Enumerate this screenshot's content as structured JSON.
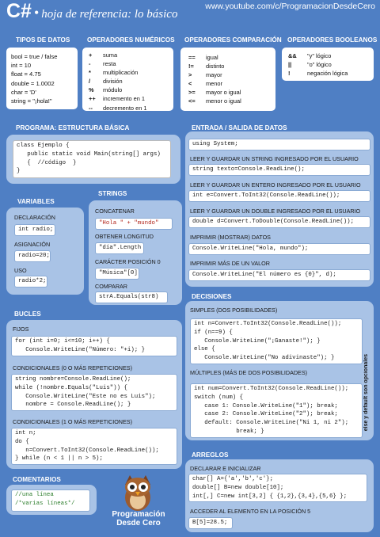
{
  "header": {
    "title": "C#",
    "separator": "•",
    "subtitle": "hoja de referencia: lo básico",
    "url": "www.youtube.com/c/ProgramacionDesdeCero"
  },
  "tipos": {
    "heading": "TIPOS DE DATOS",
    "lines": [
      "bool = true / false",
      "int = 10",
      "float = 4.75",
      "double = 1.0002",
      "char = 'D'",
      "string = \"¡hola!\""
    ]
  },
  "numericos": {
    "heading": "OPERADORES NUMÉRICOS",
    "rows": [
      [
        "+",
        "suma"
      ],
      [
        "-",
        "resta"
      ],
      [
        "*",
        "multiplicación"
      ],
      [
        "/",
        "división"
      ],
      [
        "%",
        "módulo"
      ],
      [
        "++",
        "incremento en 1"
      ],
      [
        "--",
        "decremento en 1"
      ]
    ]
  },
  "comparacion": {
    "heading": "OPERADORES COMPARACIÓN",
    "rows": [
      [
        "==",
        "igual"
      ],
      [
        "!=",
        "distinto"
      ],
      [
        ">",
        "mayor"
      ],
      [
        "<",
        "menor"
      ],
      [
        ">=",
        "mayor o igual"
      ],
      [
        "<=",
        "menor o igual"
      ]
    ]
  },
  "booleanos": {
    "heading": "OPERADORES BOOLEANOS",
    "rows": [
      [
        "&&",
        "\"y\" lógico"
      ],
      [
        "||",
        "\"o\" lógico"
      ],
      [
        "!",
        "negación lógica"
      ]
    ]
  },
  "programa": {
    "heading": "PROGRAMA: ESTRUCTURA BÁSICA",
    "code": [
      "class Ejemplo {",
      "   public static void Main(string[] args)",
      "   {  //código  }",
      "}"
    ]
  },
  "variables": {
    "heading": "VARIABLES",
    "declaracion_label": "DECLARACIÓN",
    "declaracion_code": "int radio;",
    "asignacion_label": "ASIGNACIÓN",
    "asignacion_code": "radio=20;",
    "uso_label": "USO",
    "uso_code": "radio*2;"
  },
  "strings": {
    "heading": "STRINGS",
    "concat_label": "CONCATENAR",
    "concat_code": "\"Hola \" + \"mundo\"",
    "longitud_label": "OBTENER LONGITUD",
    "longitud_code": "\"día\".Length",
    "caracter_label": "CARÁCTER POSICIÓN 0",
    "caracter_code": "\"Música\"[0]",
    "comparar_label": "COMPARAR",
    "comparar_code": "strA.Equals(str8)"
  },
  "entrada": {
    "heading": "ENTRADA / SALIDA DE DATOS",
    "using_code": "using System;",
    "leer_string_label": "LEER Y GUARDAR UN STRING INGRESADO POR EL USUARIO",
    "leer_string_code": "string texto=Console.ReadLine();",
    "leer_entero_label": "LEER Y GUARDAR UN ENTERO INGRESADO POR EL USUARIO",
    "leer_entero_code": "int e=Convert.ToInt32(Console.ReadLine());",
    "leer_double_label": "LEER Y GUARDAR UN DOUBLE INGRESADO POR EL USUARIO",
    "leer_double_code": "double d=Convert.ToDouble(Console.ReadLine());",
    "imprimir_label": "IMPRIMIR (MOSTRAR) DATOS",
    "imprimir_code": "Console.WriteLine(\"Hola, mundo\");",
    "imprimir_mas_label": "IMPRIMIR MÁS DE UN VALOR",
    "imprimir_mas_code": "Console.WriteLine(\"El número es {0}\", d);"
  },
  "bucles": {
    "heading": "BUCLES",
    "fijos_label": "FIJOS",
    "fijos_code": [
      "for (int i=0; i<=10; i++) {",
      "   Console.WriteLine(\"Número: \"+i); }"
    ],
    "cond0_label": "CONDICIONALES (0 O MÁS REPETICIONES)",
    "cond0_code": [
      "string nombre=Console.ReadLine();",
      "while (!nombre.Equals(\"Luis\")) {",
      "   Console.WriteLine(\"Este no es Luis\");",
      "   nombre = Console.ReadLine(); }"
    ],
    "cond1_label": "CONDICIONALES (1 O MÁS REPETICIONES)",
    "cond1_code": [
      "int n;",
      "do {",
      "   n=Convert.ToInt32(Console.ReadLine());",
      "} while (n < 1 || n > 5);"
    ]
  },
  "decisiones": {
    "heading": "DECISIONES",
    "simples_label": "SIMPLES (DOS POSIBILIDADES)",
    "simples_code": [
      "int n=Convert.ToInt32(Console.ReadLine());",
      "if (n==9) {",
      "   Console.WriteLine(\"¡Ganaste!\"); }",
      "else {",
      "   Console.WriteLine(\"No adivinaste\"); }"
    ],
    "multiples_label": "MÚLTIPLES (MÁS DE DOS POSIBILIDADES)",
    "multiples_code": [
      "int num=Convert.ToInt32(Console.ReadLine());",
      "switch (num) {",
      "   case 1: Console.WriteLine(\"1\"); break;",
      "   case 2: Console.WriteLine(\"2\"); break;",
      "   default: Console.WriteLine(\"Ni 1, ni 2\");",
      "            break; }"
    ],
    "side_note": "else y default son opcionales"
  },
  "comentarios": {
    "heading": "COMENTARIOS",
    "code": [
      "//una línea",
      "/*varias líneas*/"
    ]
  },
  "arreglos": {
    "heading": "ARREGLOS",
    "declarar_label": "DECLARAR E INICIALIZAR",
    "declarar_code": [
      "char[] A={'a','b','c'};",
      "double[] B=new double[10];",
      "int[,] C=new int[3,2] { {1,2},{3,4},{5,6} };"
    ],
    "acceder_label": "ACCEDER AL ELEMENTO EN LA POSICIÓN 5",
    "acceder_code": "B[5]=28.5;"
  },
  "logo": {
    "line1": "Programación",
    "line2": "Desde Cero"
  }
}
